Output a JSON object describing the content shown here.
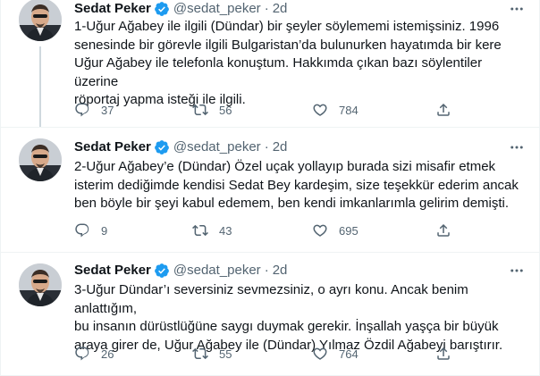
{
  "tweets": [
    {
      "author_name": "Sedat Peker",
      "handle": "@sedat_peker",
      "separator": "·",
      "time": "2d",
      "lines": [
        "1-Uğur Ağabey ile ilgili (Dündar) bir şeyler söylememi istemişsiniz. 1996",
        "senesinde bir görevle ilgili Bulgaristan’da bulunurken hayatımda bir kere",
        "Uğur Ağabey ile telefonla konuştum. Hakkımda çıkan bazı söylentiler üzerine",
        "röportaj yapma isteği ile ilgili."
      ],
      "replies": "37",
      "retweets": "56",
      "likes": "784"
    },
    {
      "author_name": "Sedat Peker",
      "handle": "@sedat_peker",
      "separator": "·",
      "time": "2d",
      "lines": [
        "2-Uğur Ağabey’e (Dündar) Özel uçak yollayıp burada sizi misafir etmek",
        "isterim dediğimde kendisi Sedat Bey kardeşim, size teşekkür ederim ancak",
        "ben böyle bir şeyi kabul edemem, ben kendi imkanlarımla gelirim demişti."
      ],
      "replies": "9",
      "retweets": "43",
      "likes": "695"
    },
    {
      "author_name": "Sedat Peker",
      "handle": "@sedat_peker",
      "separator": "·",
      "time": "2d",
      "lines": [
        "3-Uğur Dündar’ı seversiniz sevmezsiniz, o ayrı konu. Ancak benim anlattığım,",
        "bu insanın dürüstlüğüne saygı duymak gerekir. İnşallah yaşça bir büyük",
        "araya girer de, Uğur Ağabey ile (Dündar) Yılmaz Özdil Ağabeyi barıştırır."
      ],
      "replies": "26",
      "retweets": "55",
      "likes": "764"
    }
  ],
  "icons": {
    "verified": "verified-badge-icon",
    "more": "more-icon",
    "reply": "reply-icon",
    "retweet": "retweet-icon",
    "like": "like-icon",
    "share": "share-icon"
  },
  "colors": {
    "verified": "#1d9bf0",
    "text": "#0f1419",
    "secondary": "#536471",
    "border": "#eff3f4",
    "thread_line": "#cfd9de"
  }
}
